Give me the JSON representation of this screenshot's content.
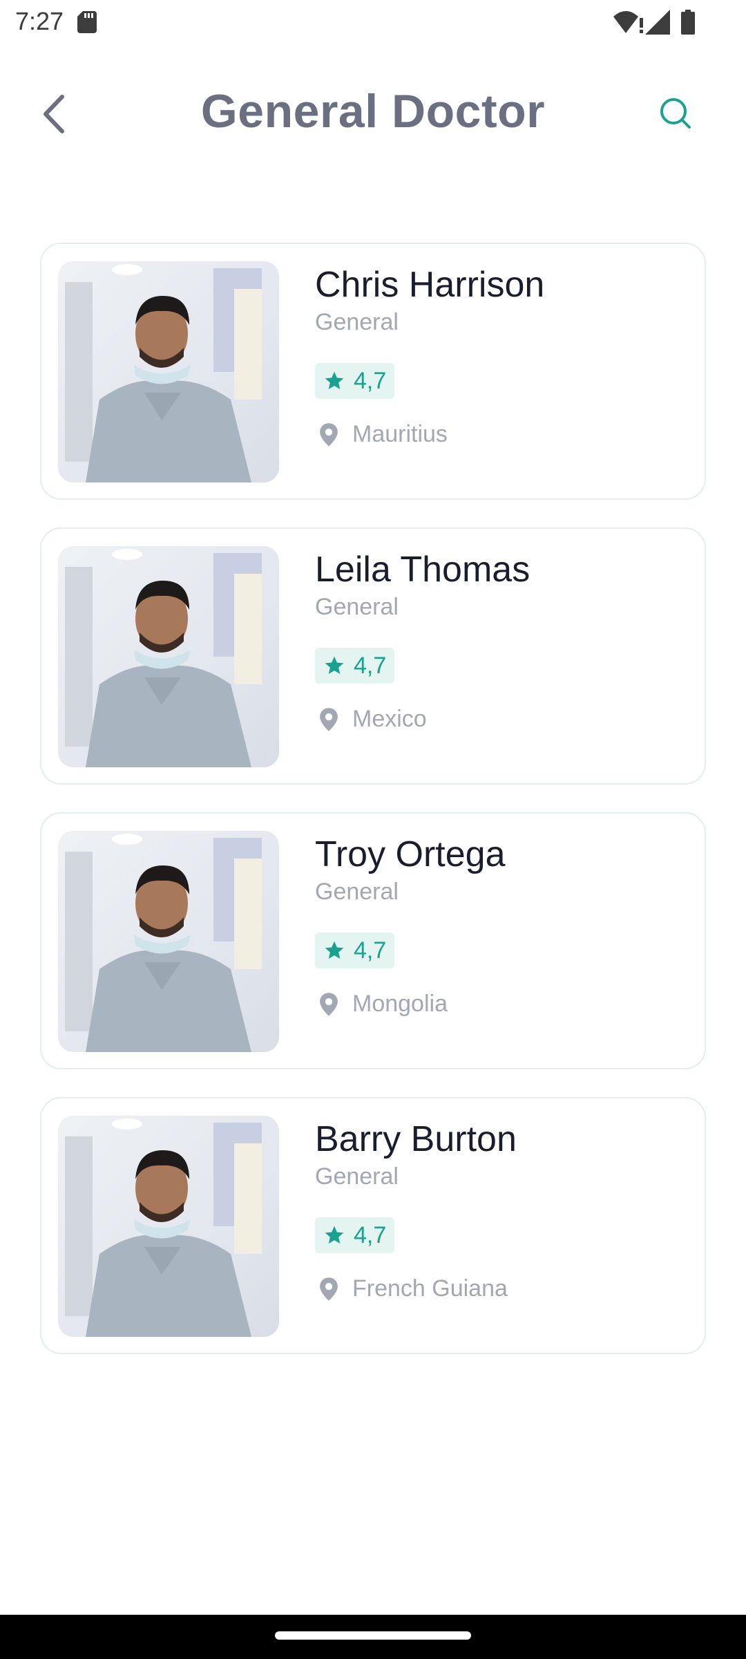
{
  "status_bar": {
    "time": "7:27"
  },
  "header": {
    "title": "General Doctor",
    "back_icon": "chevron-left-icon",
    "search_icon": "search-icon"
  },
  "colors": {
    "accent": "#1aa190",
    "title": "#6b6f82",
    "name": "#1a1d2e",
    "muted": "#a2a7b4",
    "rating_bg": "#e3f4f1",
    "card_border": "#e2eef0"
  },
  "doctors": [
    {
      "name": "Chris Harrison",
      "specialty": "General",
      "rating": "4,7",
      "location": "Mauritius"
    },
    {
      "name": "Leila Thomas",
      "specialty": "General",
      "rating": "4,7",
      "location": "Mexico"
    },
    {
      "name": "Troy Ortega",
      "specialty": "General",
      "rating": "4,7",
      "location": "Mongolia"
    },
    {
      "name": "Barry Burton",
      "specialty": "General",
      "rating": "4,7",
      "location": "French Guiana"
    }
  ]
}
